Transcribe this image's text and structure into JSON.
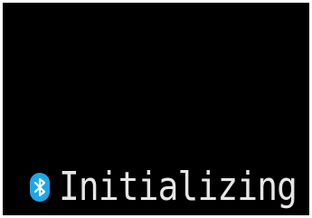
{
  "device": {
    "status_text": "Initializing",
    "status_icon": "bluetooth-icon",
    "colors": {
      "screen_background": "#000000",
      "text": "#e6e6e6",
      "bluetooth_badge": "#1ea7e8",
      "bluetooth_symbol": "#ffffff"
    }
  }
}
